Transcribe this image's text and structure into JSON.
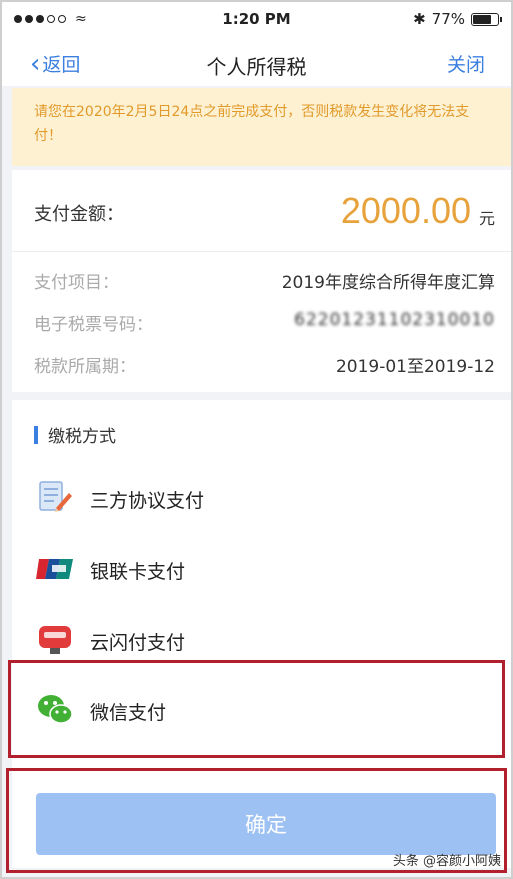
{
  "status_bar": {
    "time": "1:20 PM",
    "battery": "77%",
    "bluetooth_icon": "bluetooth-icon"
  },
  "nav": {
    "back_label": "返回",
    "title": "个人所得税",
    "close_label": "关闭"
  },
  "notice": {
    "text": "请您在2020年2月5日24点之前完成支付，否则税款发生变化将无法支付！"
  },
  "payment": {
    "amount_label": "支付金额：",
    "amount": "2000.00",
    "unit": "元",
    "details": [
      {
        "key": "支付项目：",
        "value": "2019年度综合所得年度汇算"
      },
      {
        "key": "电子税票号码：",
        "value": "62201231102310010"
      },
      {
        "key": "税款所属期：",
        "value": "2019-01至2019-12"
      }
    ]
  },
  "methods": {
    "title": "缴税方式",
    "items": [
      {
        "label": "三方协议支付",
        "icon": "agreement-pen-icon"
      },
      {
        "label": "银联卡支付",
        "icon": "unionpay-icon"
      },
      {
        "label": "云闪付支付",
        "icon": "cloud-quickpass-icon"
      },
      {
        "label": "微信支付",
        "icon": "wechat-icon"
      }
    ]
  },
  "confirm_label": "确定",
  "watermark": "头条 @容颜小阿姨",
  "colors": {
    "accent": "#3b7fe0",
    "amount": "#e7a23c",
    "notice_bg": "#fdf1d2",
    "highlight": "#b2202e"
  }
}
